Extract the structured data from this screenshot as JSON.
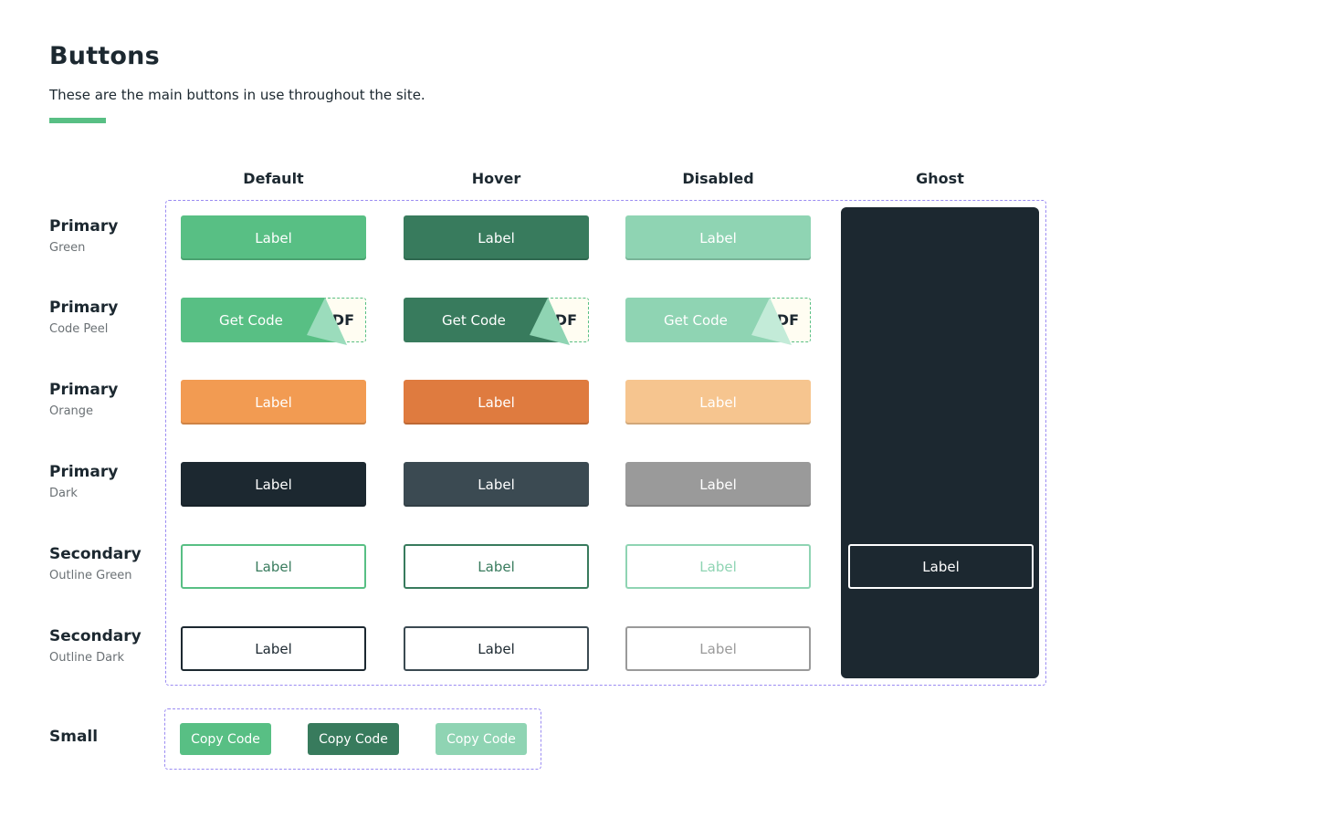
{
  "page": {
    "title": "Buttons",
    "subtitle": "These are the main buttons in use throughout the site.",
    "accent_color": "#58bf84"
  },
  "columns": [
    "Default",
    "Hover",
    "Disabled",
    "Ghost"
  ],
  "rows": [
    {
      "title": "Primary",
      "subtitle": "Green"
    },
    {
      "title": "Primary",
      "subtitle": "Code Peel"
    },
    {
      "title": "Primary",
      "subtitle": "Orange"
    },
    {
      "title": "Primary",
      "subtitle": "Dark"
    },
    {
      "title": "Secondary",
      "subtitle": "Outline Green"
    },
    {
      "title": "Secondary",
      "subtitle": "Outline Dark"
    }
  ],
  "buttons": {
    "label": "Label",
    "peel_label": "Get Code",
    "peel_code": "DF",
    "ghost_label": "Label"
  },
  "small": {
    "title": "Small",
    "label": "Copy Code"
  },
  "colors": {
    "green": "#58bf84",
    "green_hover": "#387b5d",
    "green_disabled": "#8fd4b3",
    "orange": "#f29b52",
    "orange_hover": "#df7b3f",
    "orange_disabled": "#f6c58f",
    "dark": "#1c2830",
    "dark_hover": "#3b4a52",
    "dark_disabled": "#9a9a9a",
    "guide_border": "#9b8cf2"
  }
}
